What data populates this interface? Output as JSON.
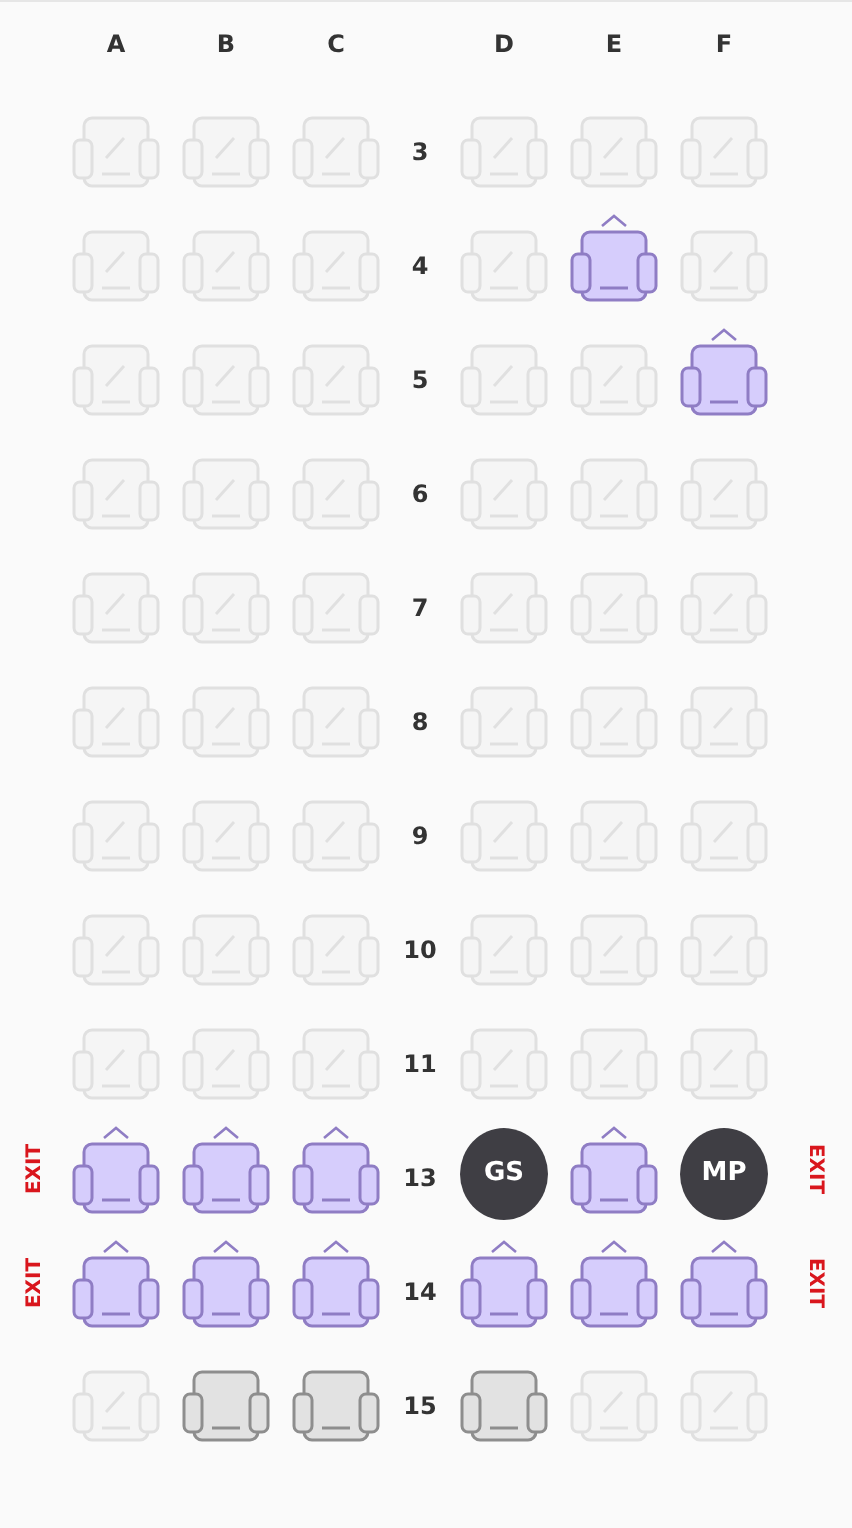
{
  "columns": [
    "A",
    "B",
    "C",
    "D",
    "E",
    "F"
  ],
  "rows": [
    {
      "number": "3",
      "seats": [
        {
          "kind": "blocked"
        },
        {
          "kind": "blocked"
        },
        {
          "kind": "blocked"
        },
        {
          "kind": "blocked"
        },
        {
          "kind": "blocked"
        },
        {
          "kind": "blocked"
        }
      ]
    },
    {
      "number": "4",
      "seats": [
        {
          "kind": "blocked"
        },
        {
          "kind": "blocked"
        },
        {
          "kind": "blocked"
        },
        {
          "kind": "blocked"
        },
        {
          "kind": "available"
        },
        {
          "kind": "blocked"
        }
      ]
    },
    {
      "number": "5",
      "seats": [
        {
          "kind": "blocked"
        },
        {
          "kind": "blocked"
        },
        {
          "kind": "blocked"
        },
        {
          "kind": "blocked"
        },
        {
          "kind": "blocked"
        },
        {
          "kind": "available"
        }
      ]
    },
    {
      "number": "6",
      "seats": [
        {
          "kind": "blocked"
        },
        {
          "kind": "blocked"
        },
        {
          "kind": "blocked"
        },
        {
          "kind": "blocked"
        },
        {
          "kind": "blocked"
        },
        {
          "kind": "blocked"
        }
      ]
    },
    {
      "number": "7",
      "seats": [
        {
          "kind": "blocked"
        },
        {
          "kind": "blocked"
        },
        {
          "kind": "blocked"
        },
        {
          "kind": "blocked"
        },
        {
          "kind": "blocked"
        },
        {
          "kind": "blocked"
        }
      ]
    },
    {
      "number": "8",
      "seats": [
        {
          "kind": "blocked"
        },
        {
          "kind": "blocked"
        },
        {
          "kind": "blocked"
        },
        {
          "kind": "blocked"
        },
        {
          "kind": "blocked"
        },
        {
          "kind": "blocked"
        }
      ]
    },
    {
      "number": "9",
      "seats": [
        {
          "kind": "blocked"
        },
        {
          "kind": "blocked"
        },
        {
          "kind": "blocked"
        },
        {
          "kind": "blocked"
        },
        {
          "kind": "blocked"
        },
        {
          "kind": "blocked"
        }
      ]
    },
    {
      "number": "10",
      "seats": [
        {
          "kind": "blocked"
        },
        {
          "kind": "blocked"
        },
        {
          "kind": "blocked"
        },
        {
          "kind": "blocked"
        },
        {
          "kind": "blocked"
        },
        {
          "kind": "blocked"
        }
      ]
    },
    {
      "number": "11",
      "seats": [
        {
          "kind": "blocked"
        },
        {
          "kind": "blocked"
        },
        {
          "kind": "blocked"
        },
        {
          "kind": "blocked"
        },
        {
          "kind": "blocked"
        },
        {
          "kind": "blocked"
        }
      ]
    },
    {
      "number": "13",
      "exit_left": "EXIT",
      "exit_right": "EXIT",
      "seats": [
        {
          "kind": "available"
        },
        {
          "kind": "available"
        },
        {
          "kind": "available"
        },
        {
          "kind": "passenger",
          "initials": "GS"
        },
        {
          "kind": "available"
        },
        {
          "kind": "passenger",
          "initials": "MP"
        }
      ]
    },
    {
      "number": "14",
      "exit_left": "EXIT",
      "exit_right": "EXIT",
      "seats": [
        {
          "kind": "available"
        },
        {
          "kind": "available"
        },
        {
          "kind": "available"
        },
        {
          "kind": "available"
        },
        {
          "kind": "available"
        },
        {
          "kind": "available"
        }
      ]
    },
    {
      "number": "15",
      "seats": [
        {
          "kind": "blocked"
        },
        {
          "kind": "taken"
        },
        {
          "kind": "taken"
        },
        {
          "kind": "taken"
        },
        {
          "kind": "blocked"
        },
        {
          "kind": "blocked"
        }
      ]
    }
  ]
}
